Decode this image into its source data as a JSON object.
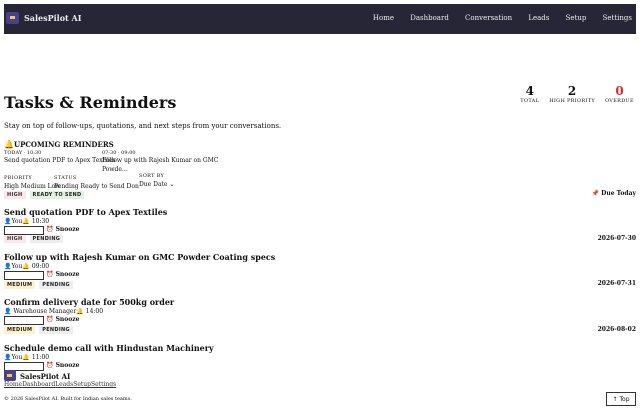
{
  "app": {
    "name": "SalesPilot AI"
  },
  "nav": [
    "Home",
    "Dashboard",
    "Conversation",
    "Leads",
    "Setup",
    "Settings"
  ],
  "page": {
    "title": "Tasks & Reminders",
    "subtitle": "Stay on top of follow-ups, quotations, and next steps from your conversations."
  },
  "stats": [
    {
      "value": "4",
      "label": "TOTAL"
    },
    {
      "value": "2",
      "label": "HIGH PRIORITY"
    },
    {
      "value": "0",
      "label": "OVERDUE"
    }
  ],
  "upcoming": {
    "heading": "UPCOMING REMINDERS",
    "items": [
      {
        "when": "TODAY · 10:30",
        "text": "Send quotation PDF to Apex Textiles"
      },
      {
        "when": "07-30 · 09:00",
        "text": "Follow up with Rajesh Kumar on GMC",
        "text2": "Powde…"
      }
    ]
  },
  "filters": {
    "priority_label": "PRIORITY",
    "priority_options": "High Medium Low",
    "status_label": "STATUS",
    "status_options": "Pending Ready to Send Done",
    "sort_label": "SORT BY",
    "sort_value": "Due Date"
  },
  "tasks": [
    {
      "title": "Send quotation PDF to Apex Textiles",
      "assignee": "You",
      "time": "10:30",
      "badges": [
        "HIGH",
        "READY TO SEND"
      ],
      "due": "Due Today"
    },
    {
      "title": "Follow up with Rajesh Kumar on GMC Powder Coating specs",
      "assignee": "You",
      "time": "09:00",
      "badges": [
        "HIGH",
        "PENDING"
      ],
      "due": "2026-07-30"
    },
    {
      "title": "Confirm delivery date for 500kg order",
      "assignee": "Warehouse Manager",
      "time": "14:00",
      "badges": [
        "MEDIUM",
        "PENDING"
      ],
      "due": "2026-07-31"
    },
    {
      "title": "Schedule demo call with Hindustan Machinery",
      "assignee": "You",
      "time": "11:00",
      "badges": [
        "MEDIUM",
        "PENDING"
      ],
      "due": "2026-08-02"
    }
  ],
  "snooze_label": "Snooze",
  "footer": {
    "brand": "SalesPilot AI",
    "links": [
      "Home",
      "Dashboard",
      "Leads",
      "Setup",
      "Settings"
    ],
    "copyright": "© 2026 SalesPilot AI. Built for Indian sales teams.",
    "top_label": "↑ Top"
  }
}
